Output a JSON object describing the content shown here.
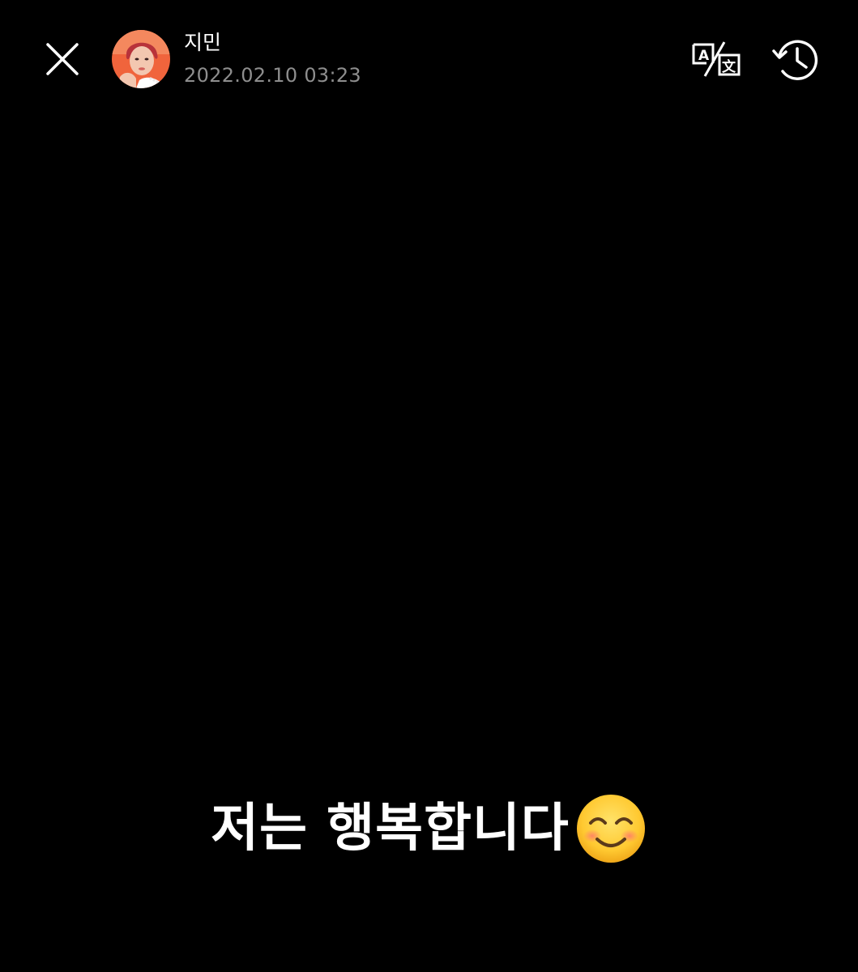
{
  "header": {
    "author_name": "지민",
    "timestamp": "2022.02.10 03:23",
    "close_icon": "close-icon",
    "translate_icon": "translate-icon",
    "history_icon": "history-icon"
  },
  "post": {
    "caption_text": "저는 행복합니다",
    "emoji": "smiling-face-with-smiling-eyes"
  },
  "colors": {
    "background": "#000000",
    "text_primary": "#ffffff",
    "text_secondary": "#8e8e8e",
    "avatar_background": "#f0643c"
  }
}
